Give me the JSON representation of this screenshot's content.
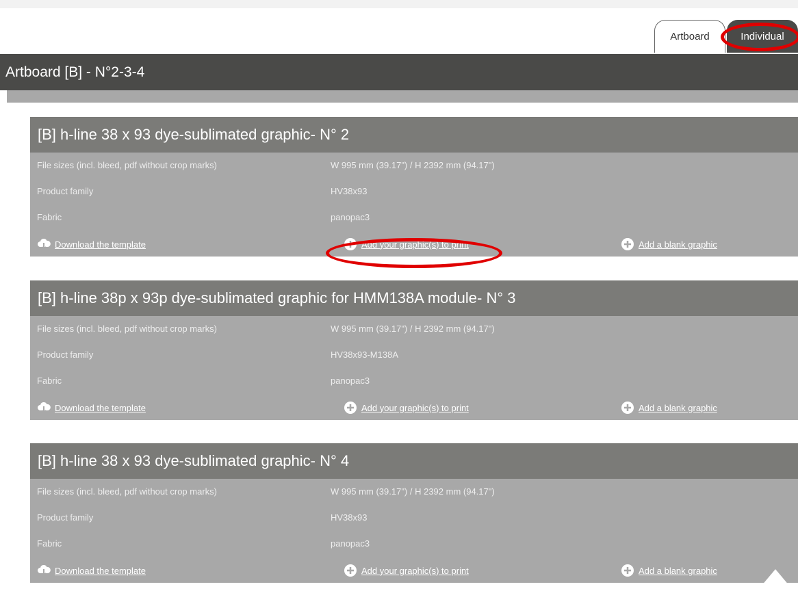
{
  "tabs": {
    "artboard": "Artboard",
    "individual": "Individual"
  },
  "header": {
    "title": "Artboard [B] - N°2-3-4"
  },
  "labels": {
    "file_sizes": "File sizes (incl. bleed, pdf without crop marks)",
    "product_family": "Product family",
    "fabric": "Fabric"
  },
  "actions": {
    "download": "Download the template",
    "add_graphic": "Add your graphic(s) to print",
    "add_blank": "Add a blank graphic"
  },
  "cards": [
    {
      "title": "[B] h-line 38 x 93 dye-sublimated graphic- N° 2",
      "file_size": "W 995 mm (39.17\") / H 2392 mm (94.17\")",
      "product_family": "HV38x93",
      "fabric": "panopac3"
    },
    {
      "title": "[B] h-line 38p x 93p dye-sublimated graphic for HMM138A module- N° 3",
      "file_size": "W 995 mm (39.17\") / H 2392 mm (94.17\")",
      "product_family": "HV38x93-M138A",
      "fabric": "panopac3"
    },
    {
      "title": "[B] h-line 38 x 93 dye-sublimated graphic- N° 4",
      "file_size": "W 995 mm (39.17\") / H 2392 mm (94.17\")",
      "product_family": "HV38x93",
      "fabric": "panopac3"
    }
  ],
  "colors": {
    "dark_bar": "#4a4a48",
    "card_title": "#7b7b78",
    "card_body": "#a8a8a8",
    "highlight": "#e00000"
  },
  "icons": [
    "cloud-download-icon",
    "plus-circle-icon",
    "chevron-up-icon"
  ]
}
